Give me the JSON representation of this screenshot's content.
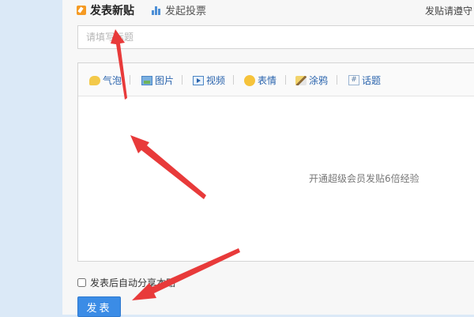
{
  "tabs": {
    "new_post": {
      "label": "发表新贴",
      "icon": "edit-icon"
    },
    "vote": {
      "label": "发起投票",
      "icon": "chart-icon"
    }
  },
  "hint_text": "发贴请遵守",
  "title_input": {
    "placeholder": "请填写标题",
    "value": ""
  },
  "toolbar": {
    "bubble": {
      "label": "气泡",
      "icon": "bubble-icon"
    },
    "image": {
      "label": "图片",
      "icon": "image-icon"
    },
    "video": {
      "label": "视频",
      "icon": "video-icon"
    },
    "emoji": {
      "label": "表情",
      "icon": "emoji-icon"
    },
    "doodle": {
      "label": "涂鸦",
      "icon": "doodle-icon"
    },
    "topic": {
      "label": "话题",
      "icon": "hashtag-icon"
    }
  },
  "editor_promo": "开通超级会员发贴6倍经验",
  "share_checkbox": {
    "label": "发表后自动分享本贴",
    "checked": false
  },
  "submit_label": "发表",
  "colors": {
    "accent": "#3b8ce6",
    "arrow": "#e83a3a",
    "link": "#2a64ad",
    "page_bg": "#dbe9f7"
  }
}
